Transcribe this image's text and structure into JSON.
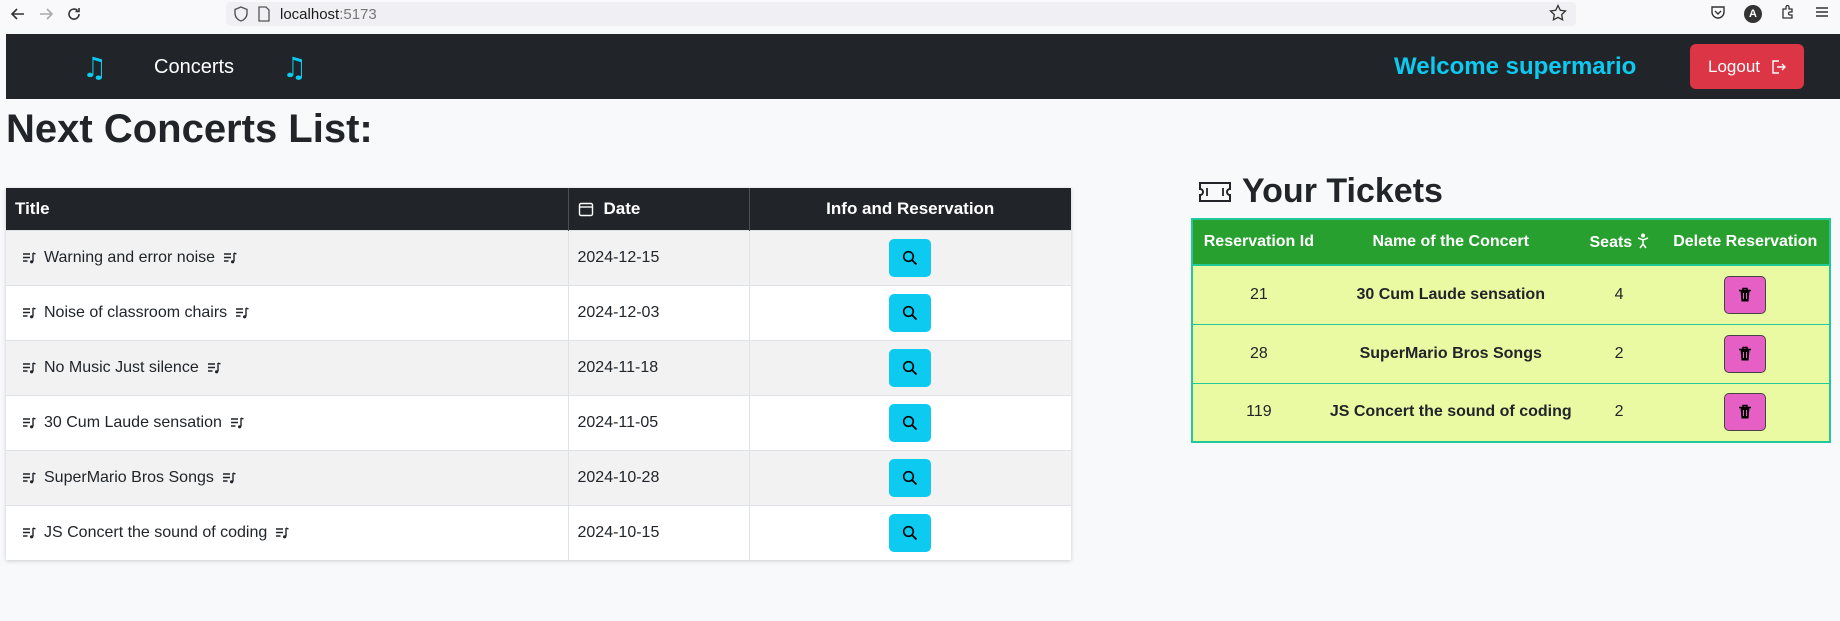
{
  "browser": {
    "url_host": "localhost",
    "url_port": ":5173",
    "profile_initial": "A"
  },
  "navbar": {
    "concerts_link": "Concerts",
    "welcome_text": "Welcome supermario",
    "logout_label": "Logout",
    "accent_color": "#0dcaf0"
  },
  "main": {
    "page_title": "Next Concerts List:"
  },
  "concerts_table": {
    "headers": {
      "title": "Title",
      "date": "Date",
      "info": "Info and Reservation"
    },
    "rows": [
      {
        "title": "Warning and error noise",
        "date": "2024-12-15"
      },
      {
        "title": "Noise of classroom chairs",
        "date": "2024-12-03"
      },
      {
        "title": "No Music Just silence",
        "date": "2024-11-18"
      },
      {
        "title": "30 Cum Laude sensation",
        "date": "2024-11-05"
      },
      {
        "title": "SuperMario Bros Songs",
        "date": "2024-10-28"
      },
      {
        "title": "JS Concert the sound of coding",
        "date": "2024-10-15"
      }
    ]
  },
  "tickets": {
    "title": "Your Tickets",
    "headers": {
      "reservation_id": "Reservation Id",
      "concert_name": "Name of the Concert",
      "seats": "Seats",
      "delete": "Delete Reservation"
    },
    "rows": [
      {
        "id": "21",
        "name": "30 Cum Laude sensation",
        "seats": "4"
      },
      {
        "id": "28",
        "name": "SuperMario Bros Songs",
        "seats": "2"
      },
      {
        "id": "119",
        "name": "JS Concert the sound of coding",
        "seats": "2"
      }
    ],
    "header_color": "#28a02f",
    "row_color": "#eafaa3",
    "delete_color": "#e65fc4"
  }
}
